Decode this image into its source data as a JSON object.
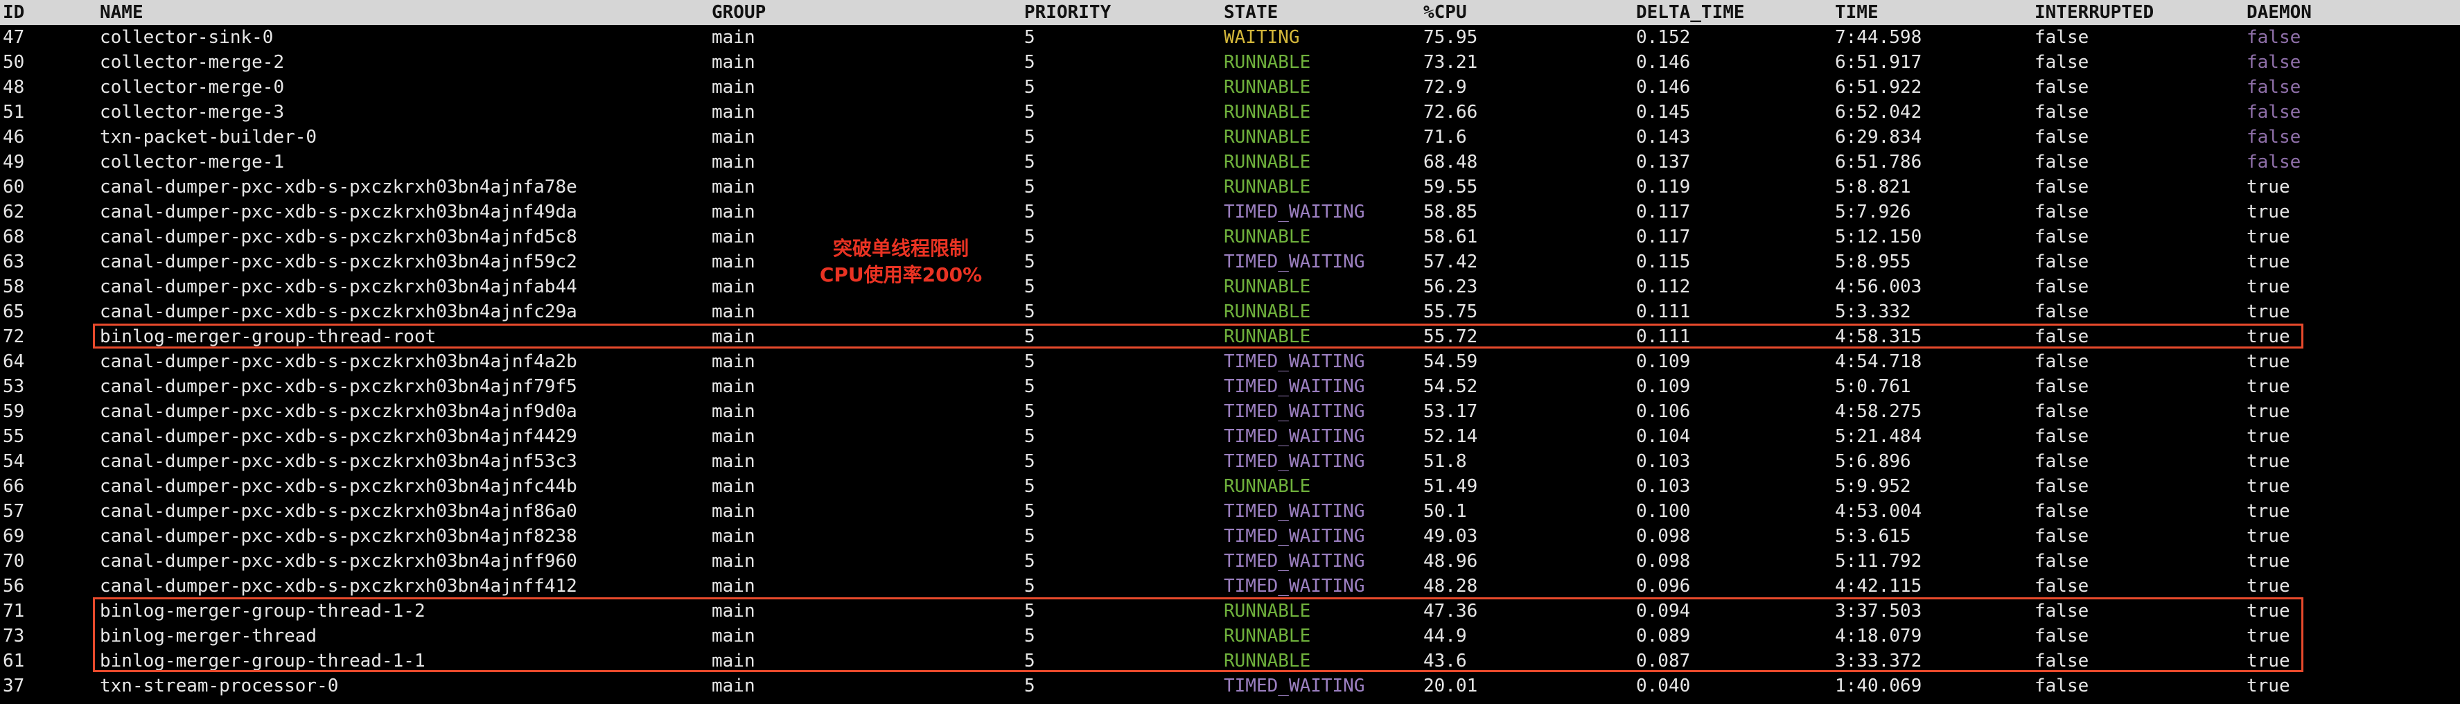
{
  "columns": [
    "ID",
    "NAME",
    "GROUP",
    "PRIORITY",
    "STATE",
    "%CPU",
    "DELTA_TIME",
    "TIME",
    "INTERRUPTED",
    "DAEMON"
  ],
  "colors": {
    "background": "#000000",
    "text": "#e6e6e6",
    "header_bg": "#d6d6d6",
    "header_text": "#111111",
    "state_runnable": "#6fb13c",
    "state_waiting": "#d4b73a",
    "state_timed_waiting": "#9b7fc0",
    "daemon_false": "#8e6fa8",
    "daemon_true": "#e6e6e6",
    "annotation": "#ea3323"
  },
  "annotation": {
    "line1": "突破单线程限制",
    "line2": "CPU使用率200%"
  },
  "rows": [
    {
      "id": "47",
      "name": "collector-sink-0",
      "group": "main",
      "priority": "5",
      "state": "WAITING",
      "cpu": "75.95",
      "delta": "0.152",
      "time": "7:44.598",
      "interrupted": "false",
      "daemon": "false"
    },
    {
      "id": "50",
      "name": "collector-merge-2",
      "group": "main",
      "priority": "5",
      "state": "RUNNABLE",
      "cpu": "73.21",
      "delta": "0.146",
      "time": "6:51.917",
      "interrupted": "false",
      "daemon": "false"
    },
    {
      "id": "48",
      "name": "collector-merge-0",
      "group": "main",
      "priority": "5",
      "state": "RUNNABLE",
      "cpu": "72.9",
      "delta": "0.146",
      "time": "6:51.922",
      "interrupted": "false",
      "daemon": "false"
    },
    {
      "id": "51",
      "name": "collector-merge-3",
      "group": "main",
      "priority": "5",
      "state": "RUNNABLE",
      "cpu": "72.66",
      "delta": "0.145",
      "time": "6:52.042",
      "interrupted": "false",
      "daemon": "false"
    },
    {
      "id": "46",
      "name": "txn-packet-builder-0",
      "group": "main",
      "priority": "5",
      "state": "RUNNABLE",
      "cpu": "71.6",
      "delta": "0.143",
      "time": "6:29.834",
      "interrupted": "false",
      "daemon": "false"
    },
    {
      "id": "49",
      "name": "collector-merge-1",
      "group": "main",
      "priority": "5",
      "state": "RUNNABLE",
      "cpu": "68.48",
      "delta": "0.137",
      "time": "6:51.786",
      "interrupted": "false",
      "daemon": "false"
    },
    {
      "id": "60",
      "name": "canal-dumper-pxc-xdb-s-pxczkrxh03bn4ajnfa78e",
      "group": "main",
      "priority": "5",
      "state": "RUNNABLE",
      "cpu": "59.55",
      "delta": "0.119",
      "time": "5:8.821",
      "interrupted": "false",
      "daemon": "true"
    },
    {
      "id": "62",
      "name": "canal-dumper-pxc-xdb-s-pxczkrxh03bn4ajnf49da",
      "group": "main",
      "priority": "5",
      "state": "TIMED_WAITING",
      "cpu": "58.85",
      "delta": "0.117",
      "time": "5:7.926",
      "interrupted": "false",
      "daemon": "true"
    },
    {
      "id": "68",
      "name": "canal-dumper-pxc-xdb-s-pxczkrxh03bn4ajnfd5c8",
      "group": "main",
      "priority": "5",
      "state": "RUNNABLE",
      "cpu": "58.61",
      "delta": "0.117",
      "time": "5:12.150",
      "interrupted": "false",
      "daemon": "true"
    },
    {
      "id": "63",
      "name": "canal-dumper-pxc-xdb-s-pxczkrxh03bn4ajnf59c2",
      "group": "main",
      "priority": "5",
      "state": "TIMED_WAITING",
      "cpu": "57.42",
      "delta": "0.115",
      "time": "5:8.955",
      "interrupted": "false",
      "daemon": "true"
    },
    {
      "id": "58",
      "name": "canal-dumper-pxc-xdb-s-pxczkrxh03bn4ajnfab44",
      "group": "main",
      "priority": "5",
      "state": "RUNNABLE",
      "cpu": "56.23",
      "delta": "0.112",
      "time": "4:56.003",
      "interrupted": "false",
      "daemon": "true"
    },
    {
      "id": "65",
      "name": "canal-dumper-pxc-xdb-s-pxczkrxh03bn4ajnfc29a",
      "group": "main",
      "priority": "5",
      "state": "RUNNABLE",
      "cpu": "55.75",
      "delta": "0.111",
      "time": "5:3.332",
      "interrupted": "false",
      "daemon": "true"
    },
    {
      "id": "72",
      "name": "binlog-merger-group-thread-root",
      "group": "main",
      "priority": "5",
      "state": "RUNNABLE",
      "cpu": "55.72",
      "delta": "0.111",
      "time": "4:58.315",
      "interrupted": "false",
      "daemon": "true"
    },
    {
      "id": "64",
      "name": "canal-dumper-pxc-xdb-s-pxczkrxh03bn4ajnf4a2b",
      "group": "main",
      "priority": "5",
      "state": "TIMED_WAITING",
      "cpu": "54.59",
      "delta": "0.109",
      "time": "4:54.718",
      "interrupted": "false",
      "daemon": "true"
    },
    {
      "id": "53",
      "name": "canal-dumper-pxc-xdb-s-pxczkrxh03bn4ajnf79f5",
      "group": "main",
      "priority": "5",
      "state": "TIMED_WAITING",
      "cpu": "54.52",
      "delta": "0.109",
      "time": "5:0.761",
      "interrupted": "false",
      "daemon": "true"
    },
    {
      "id": "59",
      "name": "canal-dumper-pxc-xdb-s-pxczkrxh03bn4ajnf9d0a",
      "group": "main",
      "priority": "5",
      "state": "TIMED_WAITING",
      "cpu": "53.17",
      "delta": "0.106",
      "time": "4:58.275",
      "interrupted": "false",
      "daemon": "true"
    },
    {
      "id": "55",
      "name": "canal-dumper-pxc-xdb-s-pxczkrxh03bn4ajnf4429",
      "group": "main",
      "priority": "5",
      "state": "TIMED_WAITING",
      "cpu": "52.14",
      "delta": "0.104",
      "time": "5:21.484",
      "interrupted": "false",
      "daemon": "true"
    },
    {
      "id": "54",
      "name": "canal-dumper-pxc-xdb-s-pxczkrxh03bn4ajnf53c3",
      "group": "main",
      "priority": "5",
      "state": "TIMED_WAITING",
      "cpu": "51.8",
      "delta": "0.103",
      "time": "5:6.896",
      "interrupted": "false",
      "daemon": "true"
    },
    {
      "id": "66",
      "name": "canal-dumper-pxc-xdb-s-pxczkrxh03bn4ajnfc44b",
      "group": "main",
      "priority": "5",
      "state": "RUNNABLE",
      "cpu": "51.49",
      "delta": "0.103",
      "time": "5:9.952",
      "interrupted": "false",
      "daemon": "true"
    },
    {
      "id": "57",
      "name": "canal-dumper-pxc-xdb-s-pxczkrxh03bn4ajnf86a0",
      "group": "main",
      "priority": "5",
      "state": "TIMED_WAITING",
      "cpu": "50.1",
      "delta": "0.100",
      "time": "4:53.004",
      "interrupted": "false",
      "daemon": "true"
    },
    {
      "id": "69",
      "name": "canal-dumper-pxc-xdb-s-pxczkrxh03bn4ajnf8238",
      "group": "main",
      "priority": "5",
      "state": "TIMED_WAITING",
      "cpu": "49.03",
      "delta": "0.098",
      "time": "5:3.615",
      "interrupted": "false",
      "daemon": "true"
    },
    {
      "id": "70",
      "name": "canal-dumper-pxc-xdb-s-pxczkrxh03bn4ajnff960",
      "group": "main",
      "priority": "5",
      "state": "TIMED_WAITING",
      "cpu": "48.96",
      "delta": "0.098",
      "time": "5:11.792",
      "interrupted": "false",
      "daemon": "true"
    },
    {
      "id": "56",
      "name": "canal-dumper-pxc-xdb-s-pxczkrxh03bn4ajnff412",
      "group": "main",
      "priority": "5",
      "state": "TIMED_WAITING",
      "cpu": "48.28",
      "delta": "0.096",
      "time": "4:42.115",
      "interrupted": "false",
      "daemon": "true"
    },
    {
      "id": "71",
      "name": "binlog-merger-group-thread-1-2",
      "group": "main",
      "priority": "5",
      "state": "RUNNABLE",
      "cpu": "47.36",
      "delta": "0.094",
      "time": "3:37.503",
      "interrupted": "false",
      "daemon": "true"
    },
    {
      "id": "73",
      "name": "binlog-merger-thread",
      "group": "main",
      "priority": "5",
      "state": "RUNNABLE",
      "cpu": "44.9",
      "delta": "0.089",
      "time": "4:18.079",
      "interrupted": "false",
      "daemon": "true"
    },
    {
      "id": "61",
      "name": "binlog-merger-group-thread-1-1",
      "group": "main",
      "priority": "5",
      "state": "RUNNABLE",
      "cpu": "43.6",
      "delta": "0.087",
      "time": "3:33.372",
      "interrupted": "false",
      "daemon": "true"
    },
    {
      "id": "37",
      "name": "txn-stream-processor-0",
      "group": "main",
      "priority": "5",
      "state": "TIMED_WAITING",
      "cpu": "20.01",
      "delta": "0.040",
      "time": "1:40.069",
      "interrupted": "false",
      "daemon": "true"
    }
  ]
}
